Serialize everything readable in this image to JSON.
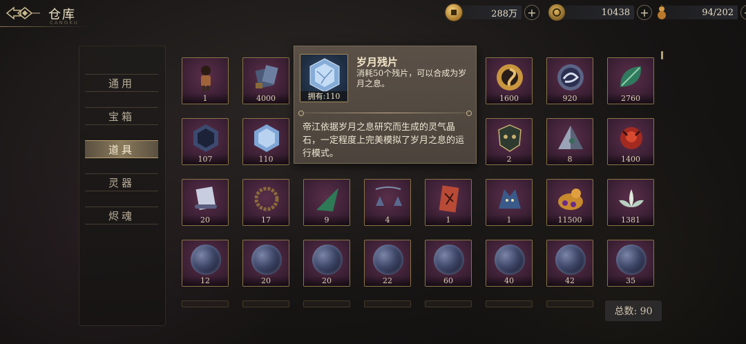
{
  "header": {
    "title": "仓库",
    "subtitle": "CANGKU"
  },
  "currencies": [
    {
      "name": "coin",
      "value": "288万",
      "icon": "coin-icon",
      "color": "#c9a04a"
    },
    {
      "name": "jade",
      "value": "10438",
      "icon": "jade-token-icon",
      "color": "#b58a3e"
    },
    {
      "name": "stamina",
      "value": "94/202",
      "icon": "gourd-icon",
      "color": "#c48a3a"
    }
  ],
  "sidebar": {
    "items": [
      {
        "label": "通用",
        "active": false
      },
      {
        "label": "宝箱",
        "active": false
      },
      {
        "label": "道具",
        "active": true
      },
      {
        "label": "灵器",
        "active": false
      },
      {
        "label": "烬魂",
        "active": false
      }
    ]
  },
  "grid": {
    "rows": [
      [
        {
          "count": "1",
          "icon": "character-figure-icon"
        },
        {
          "count": "4000",
          "icon": "scroll-book-icon"
        },
        {
          "count": "",
          "icon": "hidden"
        },
        {
          "count": "",
          "icon": "hidden"
        },
        {
          "count": "",
          "icon": "hidden"
        },
        {
          "count": "1600",
          "icon": "golden-swirl-coin-icon"
        },
        {
          "count": "920",
          "icon": "dragon-medallion-icon"
        },
        {
          "count": "2760",
          "icon": "green-leaf-icon"
        }
      ],
      [
        {
          "count": "107",
          "icon": "dark-crystal-icon"
        },
        {
          "count": "110",
          "icon": "blue-crystal-icon"
        },
        {
          "count": "",
          "icon": "hidden"
        },
        {
          "count": "",
          "icon": "hidden"
        },
        {
          "count": "",
          "icon": "hidden"
        },
        {
          "count": "2",
          "icon": "mask-shield-icon"
        },
        {
          "count": "8",
          "icon": "pyramid-gem-icon"
        },
        {
          "count": "1400",
          "icon": "red-beast-icon"
        }
      ],
      [
        {
          "count": "20",
          "icon": "paper-scroll-icon"
        },
        {
          "count": "17",
          "icon": "bead-bracelet-icon"
        },
        {
          "count": "9",
          "icon": "green-shard-icon"
        },
        {
          "count": "4",
          "icon": "chime-bells-icon"
        },
        {
          "count": "1",
          "icon": "red-talisman-icon"
        },
        {
          "count": "1",
          "icon": "wolf-spirit-icon"
        },
        {
          "count": "11500",
          "icon": "golden-dragon-icon"
        },
        {
          "count": "1381",
          "icon": "lotus-icon"
        }
      ],
      [
        {
          "count": "12",
          "icon": "spirit-orb-icon"
        },
        {
          "count": "20",
          "icon": "spirit-orb-icon"
        },
        {
          "count": "20",
          "icon": "spirit-orb-icon"
        },
        {
          "count": "22",
          "icon": "spirit-orb-icon"
        },
        {
          "count": "60",
          "icon": "spirit-orb-icon"
        },
        {
          "count": "40",
          "icon": "spirit-orb-icon"
        },
        {
          "count": "42",
          "icon": "spirit-orb-icon"
        },
        {
          "count": "35",
          "icon": "spirit-orb-icon"
        }
      ]
    ]
  },
  "total": {
    "label": "总数: 90"
  },
  "tooltip": {
    "name": "岁月残片",
    "owned": "拥有:110",
    "desc": "消耗50个残片，可以合成为岁月之息。",
    "lore": "帝江依据岁月之息研究而生成的灵气晶石，一定程度上完美模拟了岁月之息的运行模式。",
    "icon": "blue-crystal-icon"
  }
}
